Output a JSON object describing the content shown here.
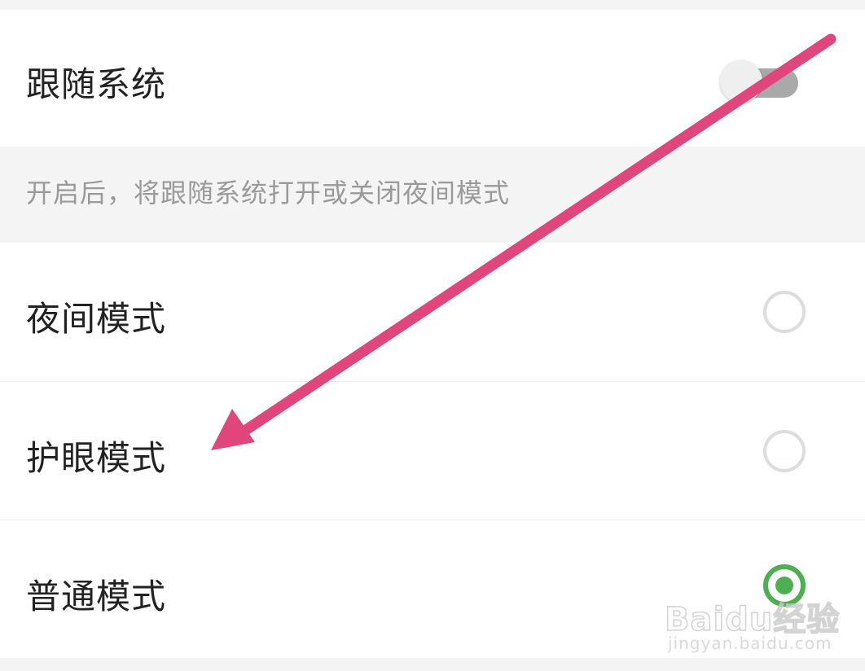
{
  "follow_system": {
    "label": "跟随系统",
    "enabled": false
  },
  "hint": {
    "text": "开启后，将跟随系统打开或关闭夜间模式"
  },
  "modes": [
    {
      "label": "夜间模式",
      "selected": false
    },
    {
      "label": "护眼模式",
      "selected": false
    },
    {
      "label": "普通模式",
      "selected": true
    }
  ],
  "annotation": {
    "arrow_color": "#e0457b",
    "points_to": "护眼模式"
  },
  "watermark": {
    "logo": "Baidu经验",
    "domain": "jingyan.baidu.com"
  },
  "colors": {
    "accent_green": "#4caf50",
    "background": "#f4f4f4",
    "hint_text": "#9a9a9a"
  }
}
